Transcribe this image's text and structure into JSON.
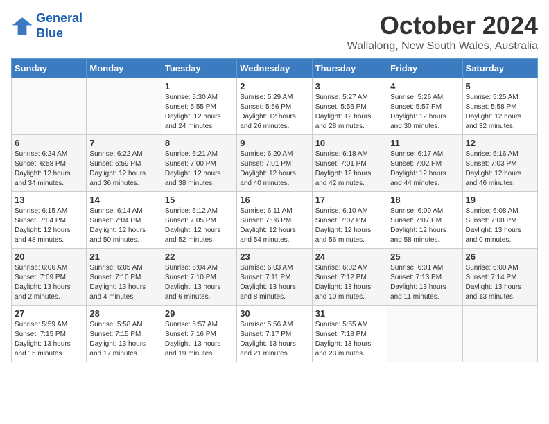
{
  "logo": {
    "line1": "General",
    "line2": "Blue"
  },
  "title": "October 2024",
  "location": "Wallalong, New South Wales, Australia",
  "days_header": [
    "Sunday",
    "Monday",
    "Tuesday",
    "Wednesday",
    "Thursday",
    "Friday",
    "Saturday"
  ],
  "weeks": [
    [
      {
        "day": "",
        "info": ""
      },
      {
        "day": "",
        "info": ""
      },
      {
        "day": "1",
        "info": "Sunrise: 5:30 AM\nSunset: 5:55 PM\nDaylight: 12 hours\nand 24 minutes."
      },
      {
        "day": "2",
        "info": "Sunrise: 5:29 AM\nSunset: 5:56 PM\nDaylight: 12 hours\nand 26 minutes."
      },
      {
        "day": "3",
        "info": "Sunrise: 5:27 AM\nSunset: 5:56 PM\nDaylight: 12 hours\nand 28 minutes."
      },
      {
        "day": "4",
        "info": "Sunrise: 5:26 AM\nSunset: 5:57 PM\nDaylight: 12 hours\nand 30 minutes."
      },
      {
        "day": "5",
        "info": "Sunrise: 5:25 AM\nSunset: 5:58 PM\nDaylight: 12 hours\nand 32 minutes."
      }
    ],
    [
      {
        "day": "6",
        "info": "Sunrise: 6:24 AM\nSunset: 6:58 PM\nDaylight: 12 hours\nand 34 minutes."
      },
      {
        "day": "7",
        "info": "Sunrise: 6:22 AM\nSunset: 6:59 PM\nDaylight: 12 hours\nand 36 minutes."
      },
      {
        "day": "8",
        "info": "Sunrise: 6:21 AM\nSunset: 7:00 PM\nDaylight: 12 hours\nand 38 minutes."
      },
      {
        "day": "9",
        "info": "Sunrise: 6:20 AM\nSunset: 7:01 PM\nDaylight: 12 hours\nand 40 minutes."
      },
      {
        "day": "10",
        "info": "Sunrise: 6:18 AM\nSunset: 7:01 PM\nDaylight: 12 hours\nand 42 minutes."
      },
      {
        "day": "11",
        "info": "Sunrise: 6:17 AM\nSunset: 7:02 PM\nDaylight: 12 hours\nand 44 minutes."
      },
      {
        "day": "12",
        "info": "Sunrise: 6:16 AM\nSunset: 7:03 PM\nDaylight: 12 hours\nand 46 minutes."
      }
    ],
    [
      {
        "day": "13",
        "info": "Sunrise: 6:15 AM\nSunset: 7:04 PM\nDaylight: 12 hours\nand 48 minutes."
      },
      {
        "day": "14",
        "info": "Sunrise: 6:14 AM\nSunset: 7:04 PM\nDaylight: 12 hours\nand 50 minutes."
      },
      {
        "day": "15",
        "info": "Sunrise: 6:12 AM\nSunset: 7:05 PM\nDaylight: 12 hours\nand 52 minutes."
      },
      {
        "day": "16",
        "info": "Sunrise: 6:11 AM\nSunset: 7:06 PM\nDaylight: 12 hours\nand 54 minutes."
      },
      {
        "day": "17",
        "info": "Sunrise: 6:10 AM\nSunset: 7:07 PM\nDaylight: 12 hours\nand 56 minutes."
      },
      {
        "day": "18",
        "info": "Sunrise: 6:09 AM\nSunset: 7:07 PM\nDaylight: 12 hours\nand 58 minutes."
      },
      {
        "day": "19",
        "info": "Sunrise: 6:08 AM\nSunset: 7:08 PM\nDaylight: 13 hours\nand 0 minutes."
      }
    ],
    [
      {
        "day": "20",
        "info": "Sunrise: 6:06 AM\nSunset: 7:09 PM\nDaylight: 13 hours\nand 2 minutes."
      },
      {
        "day": "21",
        "info": "Sunrise: 6:05 AM\nSunset: 7:10 PM\nDaylight: 13 hours\nand 4 minutes."
      },
      {
        "day": "22",
        "info": "Sunrise: 6:04 AM\nSunset: 7:10 PM\nDaylight: 13 hours\nand 6 minutes."
      },
      {
        "day": "23",
        "info": "Sunrise: 6:03 AM\nSunset: 7:11 PM\nDaylight: 13 hours\nand 8 minutes."
      },
      {
        "day": "24",
        "info": "Sunrise: 6:02 AM\nSunset: 7:12 PM\nDaylight: 13 hours\nand 10 minutes."
      },
      {
        "day": "25",
        "info": "Sunrise: 6:01 AM\nSunset: 7:13 PM\nDaylight: 13 hours\nand 11 minutes."
      },
      {
        "day": "26",
        "info": "Sunrise: 6:00 AM\nSunset: 7:14 PM\nDaylight: 13 hours\nand 13 minutes."
      }
    ],
    [
      {
        "day": "27",
        "info": "Sunrise: 5:59 AM\nSunset: 7:15 PM\nDaylight: 13 hours\nand 15 minutes."
      },
      {
        "day": "28",
        "info": "Sunrise: 5:58 AM\nSunset: 7:15 PM\nDaylight: 13 hours\nand 17 minutes."
      },
      {
        "day": "29",
        "info": "Sunrise: 5:57 AM\nSunset: 7:16 PM\nDaylight: 13 hours\nand 19 minutes."
      },
      {
        "day": "30",
        "info": "Sunrise: 5:56 AM\nSunset: 7:17 PM\nDaylight: 13 hours\nand 21 minutes."
      },
      {
        "day": "31",
        "info": "Sunrise: 5:55 AM\nSunset: 7:18 PM\nDaylight: 13 hours\nand 23 minutes."
      },
      {
        "day": "",
        "info": ""
      },
      {
        "day": "",
        "info": ""
      }
    ]
  ]
}
